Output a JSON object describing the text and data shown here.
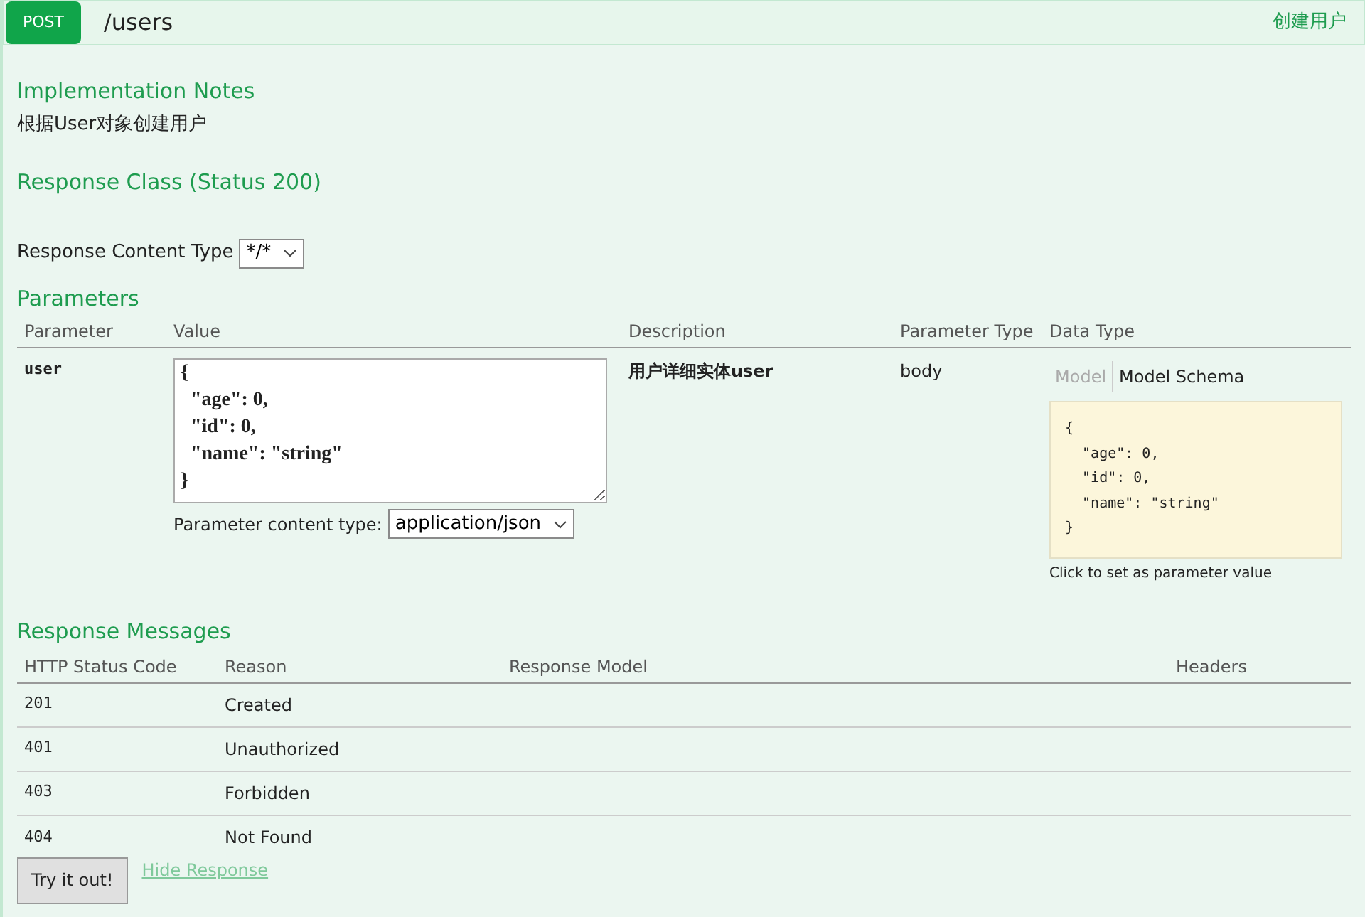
{
  "header": {
    "method": "POST",
    "path": "/users",
    "summary": "创建用户"
  },
  "implementation_notes": {
    "title": "Implementation Notes",
    "text": "根据User对象创建用户"
  },
  "response_class": {
    "title": "Response Class (Status 200)"
  },
  "response_content_type": {
    "label": "Response Content Type",
    "value": "*/*"
  },
  "parameters": {
    "title": "Parameters",
    "columns": [
      "Parameter",
      "Value",
      "Description",
      "Parameter Type",
      "Data Type"
    ],
    "rows": [
      {
        "name": "user",
        "value": "{\n  \"age\": 0,\n  \"id\": 0,\n  \"name\": \"string\"\n}",
        "content_type_label": "Parameter content type:",
        "content_type": "application/json",
        "description": "用户详细实体user",
        "parameter_type": "body",
        "model_tabs": [
          {
            "label": "Model",
            "selected": false
          },
          {
            "label": "Model Schema",
            "selected": true
          }
        ],
        "schema": "{\n  \"age\": 0,\n  \"id\": 0,\n  \"name\": \"string\"\n}",
        "schema_hint": "Click to set as parameter value"
      }
    ]
  },
  "response_messages": {
    "title": "Response Messages",
    "columns": [
      "HTTP Status Code",
      "Reason",
      "Response Model",
      "Headers"
    ],
    "rows": [
      {
        "code": "201",
        "reason": "Created"
      },
      {
        "code": "401",
        "reason": "Unauthorized"
      },
      {
        "code": "403",
        "reason": "Forbidden"
      },
      {
        "code": "404",
        "reason": "Not Found"
      }
    ]
  },
  "actions": {
    "try_button": "Try it out!",
    "hide_link": "Hide Response"
  }
}
